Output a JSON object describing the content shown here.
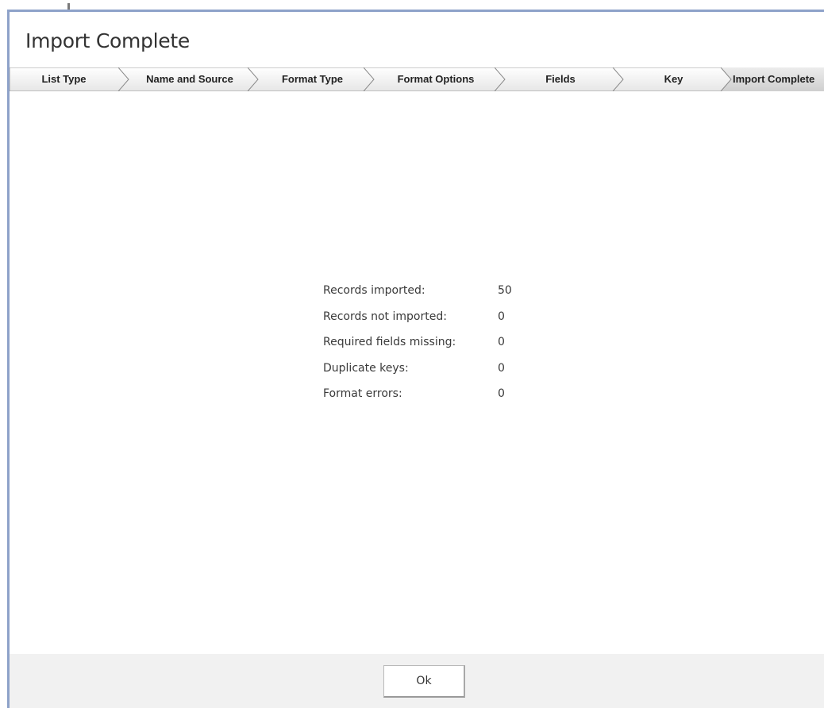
{
  "dialog": {
    "title": "Import Complete"
  },
  "wizard": {
    "steps": [
      {
        "label": "List Type",
        "active": false
      },
      {
        "label": "Name and Source",
        "active": false
      },
      {
        "label": "Format Type",
        "active": false
      },
      {
        "label": "Format Options",
        "active": false
      },
      {
        "label": "Fields",
        "active": false
      },
      {
        "label": "Key",
        "active": false
      },
      {
        "label": "Import Complete",
        "active": true
      }
    ]
  },
  "summary": {
    "rows": [
      {
        "label": "Records imported:",
        "value": "50"
      },
      {
        "label": "Records not imported:",
        "value": "0"
      },
      {
        "label": "Required fields missing:",
        "value": "0"
      },
      {
        "label": "Duplicate keys:",
        "value": "0"
      },
      {
        "label": "Format errors:",
        "value": "0"
      }
    ]
  },
  "footer": {
    "ok_label": "Ok"
  },
  "colors": {
    "border_accent": "#8ea2c9",
    "step_fill_top": "#ffffff",
    "step_fill_bottom": "#e6e6e6",
    "step_active_top": "#ececec",
    "step_active_bottom": "#cfcfcf",
    "footer_bg": "#f1f1f1"
  }
}
